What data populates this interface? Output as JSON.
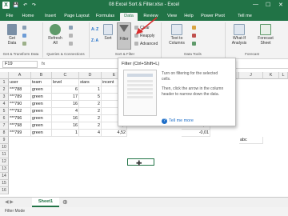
{
  "window": {
    "title": "08 Excel Sort & Filter.xlsx - Excel",
    "controls": [
      "—",
      "☐",
      "✕"
    ]
  },
  "tabs": [
    "File",
    "Home",
    "Insert",
    "Page Layout",
    "Formulas",
    "Data",
    "Review",
    "View",
    "Help",
    "Power Pivot",
    "Tell me"
  ],
  "active_tab": "Data",
  "ribbon": {
    "get_data": {
      "get": "Get",
      "data": "Data"
    },
    "refresh": {
      "refresh": "Refresh",
      "all": "All"
    },
    "sort": "Sort",
    "sort_az": "A↓Z",
    "filter": "Filter",
    "clear": "Clear",
    "reapply": "Reapply",
    "advanced": "Advanced",
    "text_to_columns": {
      "l1": "Text to",
      "l2": "Columns"
    },
    "what_if": {
      "l1": "What-If",
      "l2": "Analysis"
    },
    "forecast": {
      "l1": "Forecast",
      "l2": "Sheet"
    },
    "groups": {
      "get_transform": "Get & Transform Data",
      "queries": "Queries & Connections",
      "sort_filter": "Sort & Filter",
      "data_tools": "Data Tools",
      "forecast": "Forecast"
    }
  },
  "formula_bar": {
    "name_box": "F19",
    "fx": "fx",
    "value": ""
  },
  "tooltip": {
    "title": "Filter (Ctrl+Shift+L)",
    "line1": "Turn on filtering for the selected",
    "line2": "cells.",
    "line3": "Then, click the arrow in the column",
    "line4": "header to narrow down the data.",
    "more": "Tell me more"
  },
  "grid": {
    "columns": [
      "A",
      "B",
      "C",
      "D",
      "E",
      "F",
      "G",
      "H",
      "I",
      "J",
      "K",
      "L"
    ],
    "rows": [
      "1",
      "2",
      "3",
      "4",
      "5",
      "6",
      "7",
      "8",
      "9",
      "10",
      "11",
      "12",
      "13",
      "14",
      "15",
      "16"
    ],
    "data": [
      [
        "user",
        "team",
        "level",
        "stars",
        "incent"
      ],
      [
        "***788",
        "green",
        "6",
        "1",
        "16"
      ],
      [
        "***789",
        "green",
        "17",
        "5",
        ""
      ],
      [
        "***790",
        "green",
        "16",
        "2",
        "18"
      ],
      [
        "***792",
        "green",
        "4",
        "2",
        "18"
      ],
      [
        "***796",
        "green",
        "16",
        "2",
        "19"
      ],
      [
        "***798",
        "green",
        "16",
        "2",
        "6,7"
      ],
      [
        "***799",
        "green",
        "1",
        "4",
        "4,52"
      ]
    ],
    "col_h": {
      "r8": "-0,01",
      "r7": "0,02"
    },
    "k9": "abc"
  },
  "sheet_tab": "Sheet1",
  "status": "Filter Mode",
  "colors": {
    "accent": "#217346",
    "annotation": "#d92b2b"
  }
}
